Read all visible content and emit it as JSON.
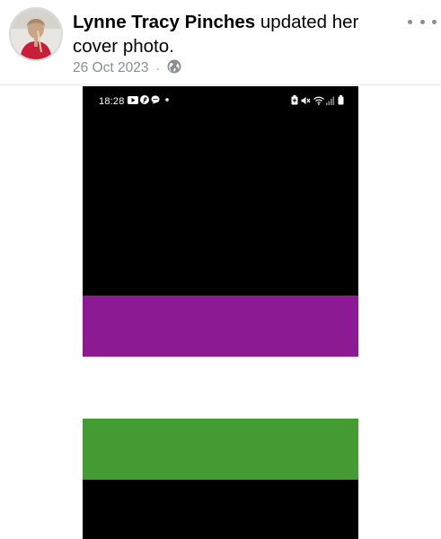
{
  "post": {
    "author": "Lynne Tracy Pinches",
    "action": " updated her cover photo.",
    "date": "26 Oct 2023",
    "separator": "·",
    "privacy_icon": "globe-icon",
    "more_icon": "more-options-icon"
  },
  "cover_photo": {
    "status_bar": {
      "time": "18:28",
      "left_icons": [
        "youtube-icon",
        "pinterest-icon",
        "message-icon",
        "dot-icon"
      ],
      "right_icons": [
        "battery-saver-icon",
        "mute-icon",
        "wifi-icon",
        "signal-icon",
        "battery-icon"
      ]
    },
    "stripes": [
      {
        "name": "black-top",
        "color": "#000000"
      },
      {
        "name": "purple",
        "color": "#8b1a93"
      },
      {
        "name": "white",
        "color": "#ffffff"
      },
      {
        "name": "green",
        "color": "#449a33"
      },
      {
        "name": "black-bottom",
        "color": "#000000"
      }
    ]
  },
  "colors": {
    "secondary_text": "#8a8d91",
    "separator": "#e4e6eb"
  }
}
